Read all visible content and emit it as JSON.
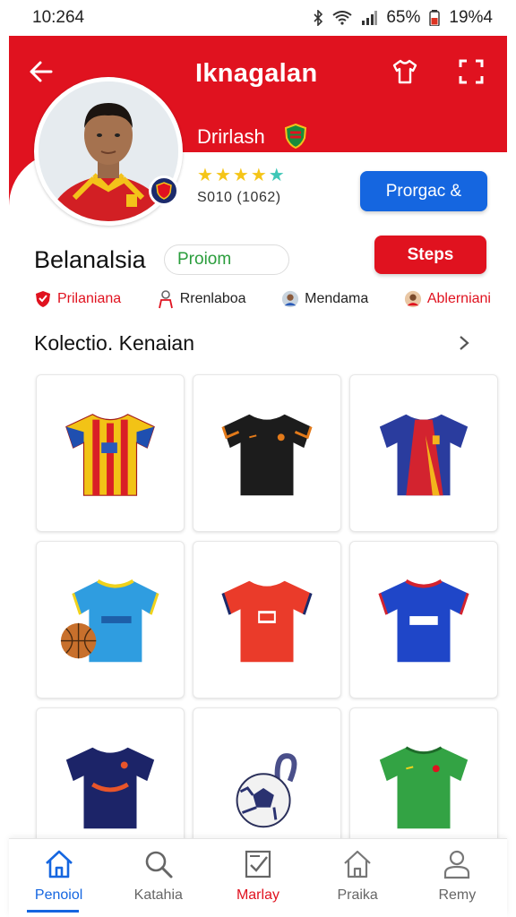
{
  "status_bar": {
    "time": "10:264",
    "battery_percent": "65%",
    "clock_right": "19%4"
  },
  "header": {
    "title": "Iknagalan",
    "player_name": "Drirlash",
    "rating_count": "S010 (1062)",
    "stars": 5,
    "follow_label": "Prorgac &",
    "colors": {
      "primary": "#e0121f",
      "accent": "#1566e0"
    }
  },
  "profile": {
    "name": "Belanalsia",
    "promo": "Proiom",
    "action_label": "Steps"
  },
  "chips": [
    {
      "label": "Prilaniana",
      "icon": "shield-icon"
    },
    {
      "label": "Rrenlaboa",
      "icon": "player-icon"
    },
    {
      "label": "Mendama",
      "icon": "avatar-icon"
    },
    {
      "label": "Ablerniani",
      "icon": "avatar-icon"
    }
  ],
  "collection": {
    "title": "Kolectio. Kenaian",
    "items": [
      {
        "name": "Red-yellow striped jersey",
        "icon": "jersey-icon"
      },
      {
        "name": "Black jersey",
        "icon": "jersey-icon"
      },
      {
        "name": "Red-blue jersey",
        "icon": "jersey-icon"
      },
      {
        "name": "Sky blue jersey",
        "icon": "jersey-icon"
      },
      {
        "name": "Red jersey",
        "icon": "jersey-icon"
      },
      {
        "name": "Royal blue jersey",
        "icon": "jersey-icon"
      },
      {
        "name": "Navy jersey",
        "icon": "jersey-icon"
      },
      {
        "name": "Football keychain",
        "icon": "football-icon"
      },
      {
        "name": "Green jersey",
        "icon": "jersey-icon"
      }
    ]
  },
  "bottom_nav": [
    {
      "label": "Penoiol",
      "icon": "home-icon",
      "state": "active"
    },
    {
      "label": "Katahia",
      "icon": "search-icon",
      "state": "default"
    },
    {
      "label": "Marlay",
      "icon": "checklist-icon",
      "state": "red"
    },
    {
      "label": "Praika",
      "icon": "house-icon",
      "state": "default"
    },
    {
      "label": "Remy",
      "icon": "person-icon",
      "state": "default"
    }
  ]
}
